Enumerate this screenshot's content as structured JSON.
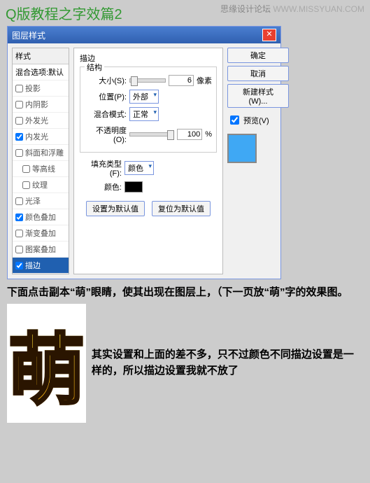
{
  "watermark": {
    "main": "思缘设计论坛",
    "url": "WWW.MISSYUAN.COM"
  },
  "page_title": "Q版教程之字效篇2",
  "dialog": {
    "title": "图层样式",
    "left": {
      "header": "样式",
      "blend": "混合选项:默认",
      "items": [
        {
          "label": "投影",
          "checked": false
        },
        {
          "label": "内阴影",
          "checked": false
        },
        {
          "label": "外发光",
          "checked": false
        },
        {
          "label": "内发光",
          "checked": true
        },
        {
          "label": "斜面和浮雕",
          "checked": false
        },
        {
          "label": "等高线",
          "checked": false,
          "indent": true
        },
        {
          "label": "纹理",
          "checked": false,
          "indent": true
        },
        {
          "label": "光泽",
          "checked": false
        },
        {
          "label": "颜色叠加",
          "checked": true
        },
        {
          "label": "渐变叠加",
          "checked": false
        },
        {
          "label": "图案叠加",
          "checked": false
        },
        {
          "label": "描边",
          "checked": true,
          "selected": true
        }
      ]
    },
    "center": {
      "group_title": "描边",
      "struct_legend": "结构",
      "size_label": "大小(S):",
      "size_value": "6",
      "size_unit": "像素",
      "pos_label": "位置(P):",
      "pos_value": "外部",
      "blend_label": "混合模式:",
      "blend_value": "正常",
      "opacity_label": "不透明度(O):",
      "opacity_value": "100",
      "opacity_unit": "%",
      "filltype_label": "填充类型(F):",
      "filltype_value": "颜色",
      "color_label": "颜色:",
      "set_default": "设置为默认值",
      "reset_default": "复位为默认值"
    },
    "right": {
      "ok": "确定",
      "cancel": "取消",
      "new_style": "新建样式(W)...",
      "preview": "预览(V)"
    }
  },
  "caption1": "下面点击副本“萌”眼睛，使其出现在图层上，（下一页放“萌”字的效果图。",
  "meng_char": "萌",
  "caption2": "其实设置和上面的差不多，只不过颜色不同描边设置是一样的，所以描边设置我就不放了"
}
